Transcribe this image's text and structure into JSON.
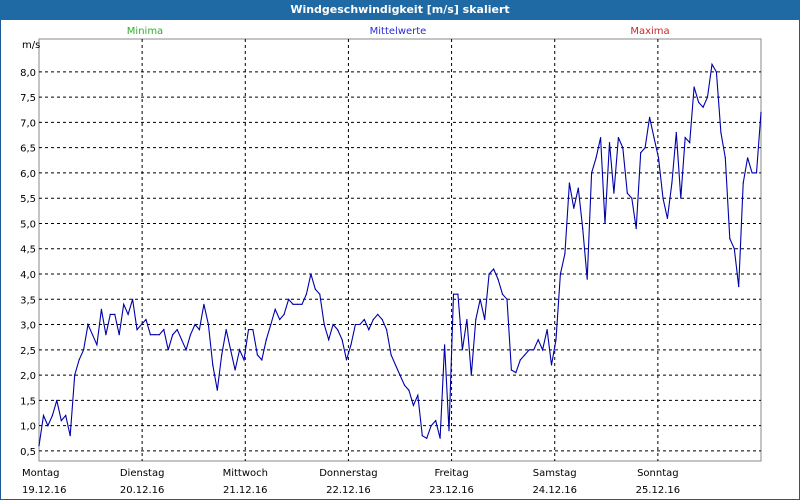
{
  "window": {
    "title": "Windgeschwindigkeit [m/s] skaliert"
  },
  "legend": {
    "minima": "Minima",
    "mittelwerte": "Mittelwerte",
    "maxima": "Maxima",
    "colors": {
      "minima": "#2bb02b",
      "mittelwerte": "#2a2ad6",
      "maxima": "#c62a2a"
    }
  },
  "chart_data": {
    "type": "line",
    "title": "Windgeschwindigkeit [m/s] skaliert",
    "ylabel": "m/s",
    "xlabel": "",
    "ylim": [
      0.3,
      8.65
    ],
    "y_ticks": [
      "0,5",
      "1,0",
      "1,5",
      "2,0",
      "2,5",
      "3,0",
      "3,5",
      "4,0",
      "4,5",
      "5,0",
      "5,5",
      "6,0",
      "6,5",
      "7,0",
      "7,5",
      "8,0"
    ],
    "x_ticks": [
      {
        "day": "Montag",
        "date": "19.12.16"
      },
      {
        "day": "Dienstag",
        "date": "20.12.16"
      },
      {
        "day": "Mittwoch",
        "date": "21.12.16"
      },
      {
        "day": "Donnerstag",
        "date": "22.12.16"
      },
      {
        "day": "Freitag",
        "date": "23.12.16"
      },
      {
        "day": "Samstag",
        "date": "24.12.16"
      },
      {
        "day": "Sonntag",
        "date": "25.12.16"
      }
    ],
    "grid": true,
    "series": [
      {
        "name": "Mittelwerte",
        "color": "#0000aa",
        "x_start": "19.12.16",
        "values": [
          0.6,
          1.2,
          1.0,
          1.2,
          1.5,
          1.1,
          1.2,
          0.8,
          2.0,
          2.3,
          2.5,
          3.0,
          2.8,
          2.6,
          3.3,
          2.8,
          3.2,
          3.2,
          2.8,
          3.4,
          3.2,
          3.5,
          2.9,
          3.0,
          3.1,
          2.8,
          2.8,
          2.8,
          2.9,
          2.5,
          2.8,
          2.9,
          2.7,
          2.5,
          2.8,
          3.0,
          2.9,
          3.4,
          3.0,
          2.2,
          1.7,
          2.4,
          2.9,
          2.5,
          2.1,
          2.5,
          2.3,
          2.9,
          2.9,
          2.4,
          2.3,
          2.7,
          3.0,
          3.3,
          3.1,
          3.2,
          3.5,
          3.4,
          3.4,
          3.4,
          3.6,
          4.0,
          3.7,
          3.6,
          3.0,
          2.7,
          3.0,
          2.9,
          2.7,
          2.3,
          2.6,
          3.0,
          3.0,
          3.1,
          2.9,
          3.1,
          3.2,
          3.1,
          2.9,
          2.4,
          2.2,
          2.0,
          1.8,
          1.7,
          1.4,
          1.6,
          0.8,
          0.75,
          1.0,
          1.1,
          0.75,
          2.6,
          0.9,
          3.6,
          3.6,
          2.5,
          3.1,
          2.0,
          3.1,
          3.5,
          3.1,
          4.0,
          4.1,
          3.9,
          3.6,
          3.5,
          2.1,
          2.05,
          2.3,
          2.4,
          2.5,
          2.5,
          2.7,
          2.5,
          2.9,
          2.2,
          2.7,
          4.0,
          4.4,
          5.8,
          5.3,
          5.7,
          4.9,
          3.9,
          6.0,
          6.3,
          6.7,
          5.0,
          6.6,
          5.6,
          6.7,
          6.5,
          5.6,
          5.5,
          4.9,
          6.4,
          6.5,
          7.1,
          6.7,
          6.3,
          5.5,
          5.1,
          5.8,
          6.8,
          5.5,
          6.7,
          6.6,
          7.7,
          7.4,
          7.3,
          7.5,
          8.15,
          8.0,
          6.8,
          6.3,
          4.7,
          4.5,
          3.75,
          5.8,
          6.3,
          6.0,
          6.0,
          7.2
        ]
      }
    ]
  }
}
